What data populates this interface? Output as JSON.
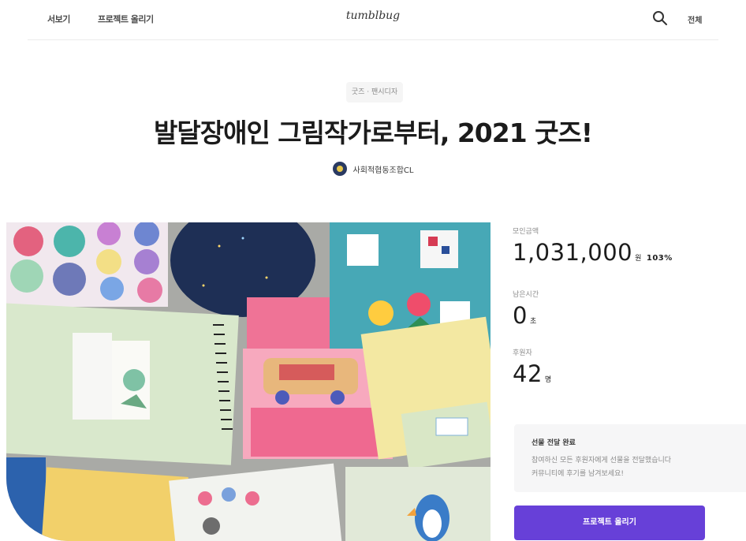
{
  "nav": {
    "left_links": [
      "서보기",
      "프로젝트 올리기"
    ],
    "logo": "tumblbug",
    "menu_label": "전체",
    "search_icon": "search-icon"
  },
  "project": {
    "category": "굿즈 · 팬시디자",
    "title": "발달장애인 그림작가로부터, 2021 굿즈!",
    "creator": "사회적협동조합CL"
  },
  "stats": {
    "funding_label": "모인금액",
    "funding_amount": "1,031,000",
    "funding_unit": "원",
    "funding_percent": "103%",
    "time_label": "남은시간",
    "time_value": "0",
    "time_unit": "초",
    "backers_label": "후원자",
    "backers_value": "42",
    "backers_unit": "명"
  },
  "notice": {
    "title": "선물 전달 완료",
    "line1": "참여하신 모든 후원자에게 선물을 전달했습니다",
    "line2": "커뮤니티에 후기를 남겨보세요!"
  },
  "cta": {
    "label": "프로젝트 올리기"
  },
  "colors": {
    "accent": "#6740d8"
  }
}
